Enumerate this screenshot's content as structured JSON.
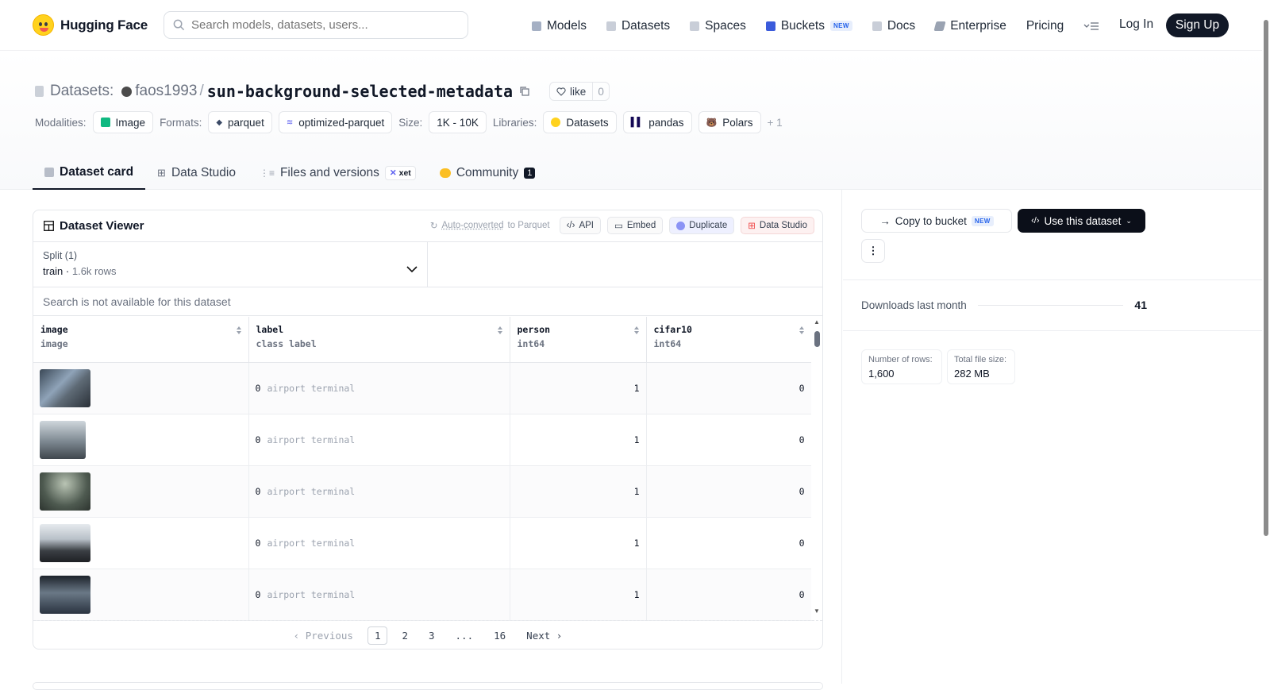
{
  "brand": "Hugging Face",
  "search": {
    "placeholder": "Search models, datasets, users..."
  },
  "nav": {
    "items": [
      "Models",
      "Datasets",
      "Spaces",
      "Buckets",
      "Docs",
      "Enterprise",
      "Pricing"
    ],
    "new_badge": "NEW",
    "login": "Log In",
    "signup": "Sign Up"
  },
  "repo": {
    "section": "Datasets:",
    "owner": "faos1993",
    "sep": "/",
    "name": "sun-background-selected-metadata",
    "like_label": "like",
    "like_count": "0"
  },
  "meta": {
    "modalities_label": "Modalities:",
    "modality": "Image",
    "formats_label": "Formats:",
    "formats": [
      "parquet",
      "optimized-parquet"
    ],
    "size_label": "Size:",
    "size": "1K - 10K",
    "libraries_label": "Libraries:",
    "libraries": [
      "Datasets",
      "pandas",
      "Polars"
    ],
    "more": "+ 1"
  },
  "tabs": {
    "card": "Dataset card",
    "studio": "Data Studio",
    "files": "Files and versions",
    "xet": "xet",
    "community": "Community",
    "community_count": "1"
  },
  "viewer": {
    "title": "Dataset Viewer",
    "auto": "Auto-converted",
    "auto_rest": "to Parquet",
    "actions": [
      "API",
      "Embed",
      "Duplicate",
      "Data Studio"
    ],
    "split_label": "Split (1)",
    "split_name": "train",
    "split_rows": "1.6k rows",
    "search_note": "Search is not available for this dataset",
    "columns": [
      {
        "name": "image",
        "type": "image"
      },
      {
        "name": "label",
        "type": "class label"
      },
      {
        "name": "person",
        "type": "int64"
      },
      {
        "name": "cifar10",
        "type": "int64"
      }
    ],
    "rows": [
      {
        "label_id": "0",
        "label_name": "airport terminal",
        "person": "1",
        "cifar10": "0"
      },
      {
        "label_id": "0",
        "label_name": "airport terminal",
        "person": "1",
        "cifar10": "0"
      },
      {
        "label_id": "0",
        "label_name": "airport terminal",
        "person": "1",
        "cifar10": "0"
      },
      {
        "label_id": "0",
        "label_name": "airport terminal",
        "person": "1",
        "cifar10": "0"
      },
      {
        "label_id": "0",
        "label_name": "airport terminal",
        "person": "1",
        "cifar10": "0"
      }
    ],
    "pager": {
      "prev": "Previous",
      "pages": [
        "1",
        "2",
        "3",
        "...",
        "16"
      ],
      "next": "Next"
    }
  },
  "side": {
    "copy_bucket": "Copy to bucket",
    "new_badge": "NEW",
    "use_dataset": "Use this dataset",
    "downloads_label": "Downloads last month",
    "downloads": "41",
    "rows_label": "Number of rows:",
    "rows_value": "1,600",
    "size_label": "Total file size:",
    "size_value": "282 MB"
  },
  "colors": {
    "accent": "#111827",
    "badge_blue": "#2563eb",
    "image_green": "#10b981"
  }
}
